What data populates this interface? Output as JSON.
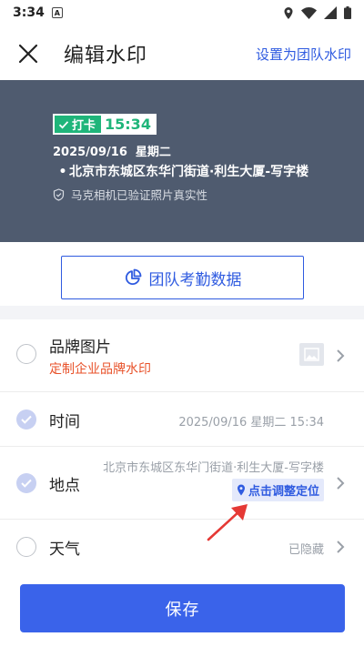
{
  "status_bar": {
    "time": "3:34",
    "notification_icon": "a-box-icon",
    "icons": [
      "location-icon",
      "wifi-icon",
      "signal-icon",
      "battery-icon"
    ]
  },
  "header": {
    "title": "编辑水印",
    "right_link": "设置为团队水印"
  },
  "preview": {
    "punch_label": "打卡",
    "punch_time": "15:34",
    "date_line": "2025/09/16  星期二",
    "bullet": "•",
    "location": "北京市东城区东华门街道·利生大厦-写字楼",
    "verify_text": "马克相机已验证照片真实性"
  },
  "team_data_button": {
    "label": "团队考勤数据"
  },
  "options": {
    "brand": {
      "label": "品牌图片",
      "sub": "定制企业品牌水印",
      "checked": false
    },
    "time": {
      "label": "时间",
      "value": "2025/09/16 星期二 15:34",
      "checked": true
    },
    "location": {
      "label": "地点",
      "value": "北京市东城区东华门街道·利生大厦-写字楼",
      "adjust_label": "点击调整定位",
      "checked": true
    },
    "weather": {
      "label": "天气",
      "value": "已隐藏",
      "checked": false
    }
  },
  "save_button": {
    "label": "保存"
  },
  "colors": {
    "accent": "#3a63ea",
    "link": "#2f5be0",
    "punch_green": "#1fb57a",
    "preview_bg": "#4f5b6f",
    "brand_sub": "#e8522a",
    "annotation_red": "#e53935"
  }
}
